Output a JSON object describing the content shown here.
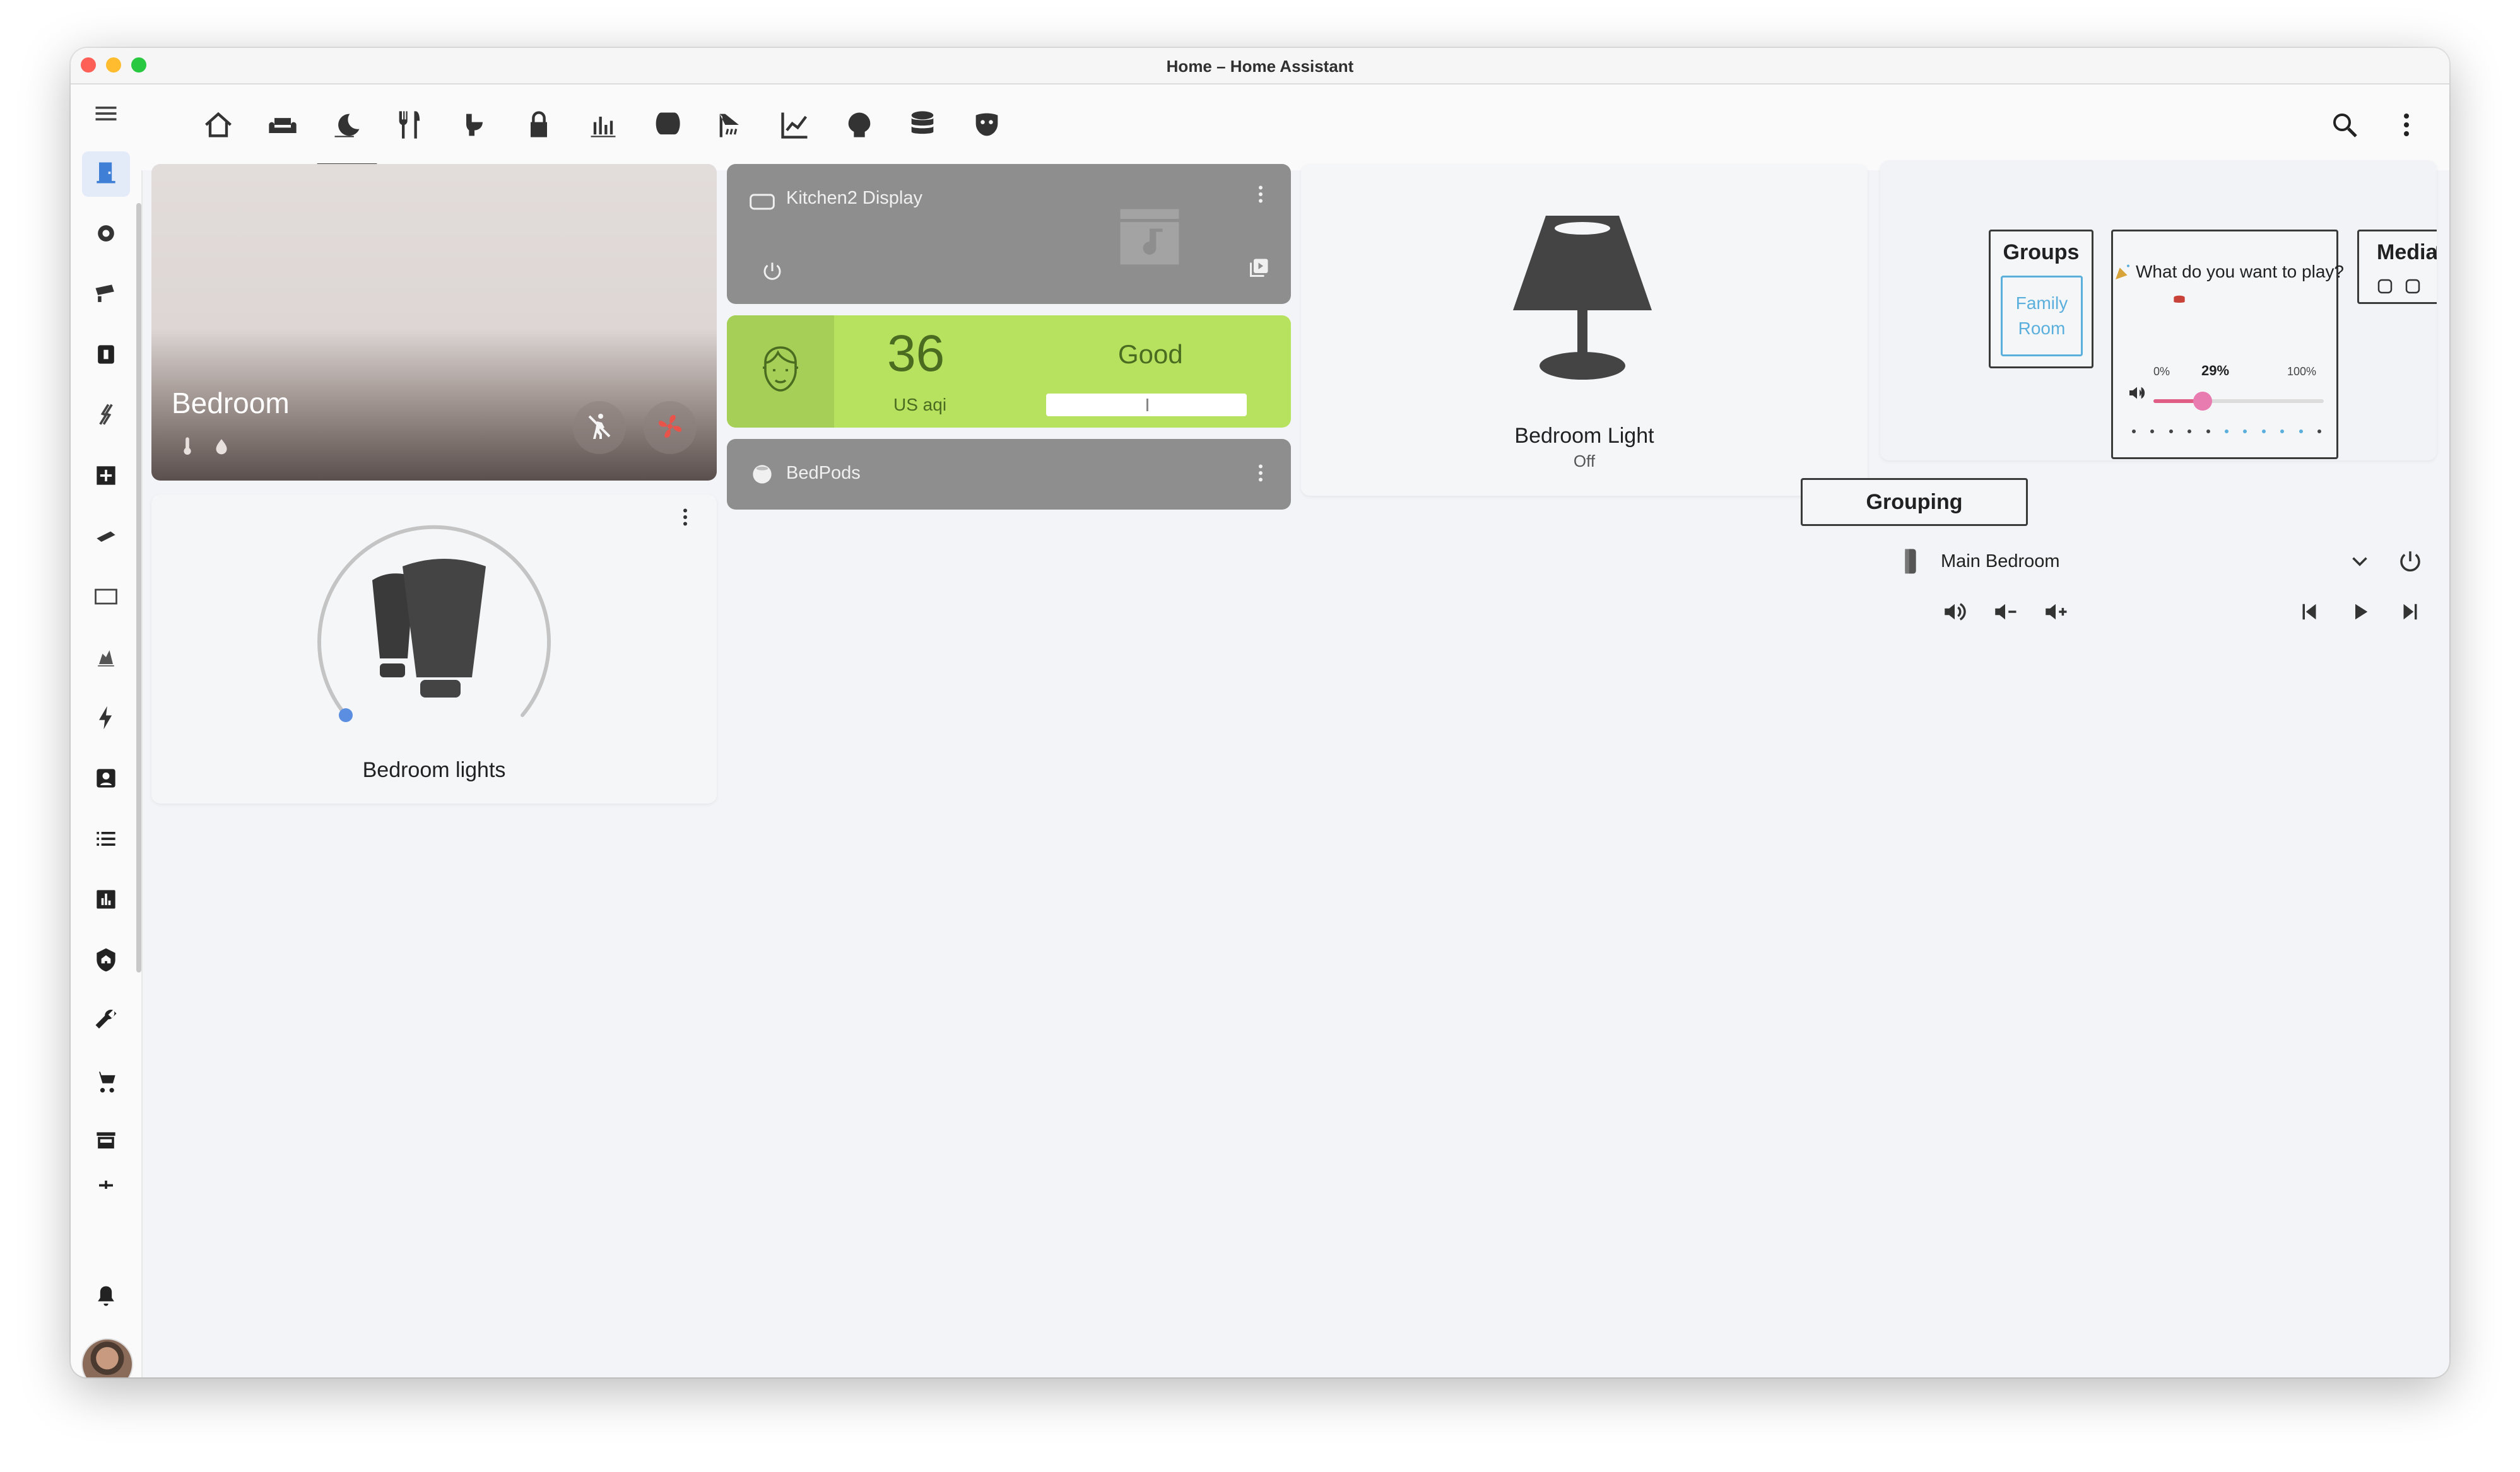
{
  "window": {
    "title": "Home – Home Assistant"
  },
  "tabs": [
    {
      "icon": "home-outline-icon"
    },
    {
      "icon": "sofa-icon"
    },
    {
      "icon": "weather-night-icon",
      "active": true
    },
    {
      "icon": "silverware-icon"
    },
    {
      "icon": "toilet-icon"
    },
    {
      "icon": "lock-icon"
    },
    {
      "icon": "chart-bar-icon"
    },
    {
      "icon": "paper-roll-icon"
    },
    {
      "icon": "shower-icon"
    },
    {
      "icon": "chart-line-icon"
    },
    {
      "icon": "brain-icon"
    },
    {
      "icon": "database-icon"
    },
    {
      "icon": "drama-masks-icon"
    }
  ],
  "sidebar": {
    "items": [
      {
        "icon": "door-icon",
        "active": true
      },
      {
        "icon": "robot-vacuum-icon"
      },
      {
        "icon": "cctv-icon"
      },
      {
        "icon": "music-box-icon"
      },
      {
        "icon": "lightning-flow-icon"
      },
      {
        "icon": "calendar-table-icon"
      },
      {
        "icon": "remote-icon"
      },
      {
        "icon": "rectangle-outline-icon"
      },
      {
        "icon": "robot-icon"
      },
      {
        "icon": "flash-icon"
      },
      {
        "icon": "account-box-icon"
      },
      {
        "icon": "format-list-bulleted-icon"
      },
      {
        "icon": "chart-box-icon"
      },
      {
        "icon": "shield-home-icon"
      },
      {
        "icon": "wrench-icon"
      },
      {
        "icon": "cart-icon"
      },
      {
        "icon": "hacs-icon"
      },
      {
        "icon": "bell-icon"
      }
    ]
  },
  "area_card": {
    "name": "Bedroom"
  },
  "light_card": {
    "name": "Bedroom lights"
  },
  "kitchen_card": {
    "name": "Kitchen2 Display"
  },
  "aqi_card": {
    "value": "36",
    "unit": "US aqi",
    "level": "Good",
    "marker_fraction": 0.5
  },
  "bedpods_card": {
    "name": "BedPods"
  },
  "lamp_card": {
    "name": "Bedroom Light",
    "state": "Off"
  },
  "groups": {
    "title": "Groups",
    "chip_line1": "Family",
    "chip_line2": "Room"
  },
  "search_prompt": {
    "text": "What do you want to play?"
  },
  "volume": {
    "min_label": "0%",
    "current_label": "29%",
    "max_label": "100%",
    "value": 29
  },
  "grouping": {
    "label": "Grouping"
  },
  "media": {
    "title": "Media"
  },
  "player": {
    "name": "Main Bedroom"
  },
  "colors": {
    "accent": "#e05e86",
    "aqi_green": "#b7e25f",
    "link_blue": "#5aafdd"
  }
}
